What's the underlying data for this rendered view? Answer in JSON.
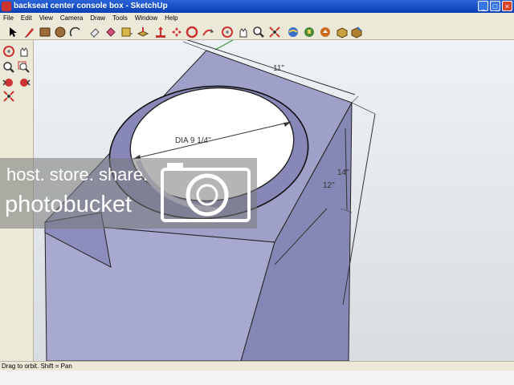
{
  "window": {
    "title": "backseat center console box - SketchUp",
    "minimize_glyph": "_",
    "maximize_glyph": "□",
    "close_glyph": "×"
  },
  "menu": {
    "items": [
      "File",
      "Edit",
      "View",
      "Camera",
      "Draw",
      "Tools",
      "Window",
      "Help"
    ]
  },
  "toolbar": {
    "icons": [
      "select-icon",
      "pencil-icon",
      "rectangle-icon",
      "circle-icon",
      "arc-icon",
      "eraser-icon",
      "paint-bucket-icon",
      "tape-measure-icon",
      "push-pull-icon",
      "move-icon",
      "rotate-icon",
      "offset-icon",
      "orbit-icon",
      "pan-icon",
      "zoom-icon",
      "zoom-extents-icon",
      "google-earth-icon",
      "get-models-icon",
      "share-model-icon",
      "components-icon",
      "get-photo-texture-icon"
    ]
  },
  "left_toolbar": {
    "icons": [
      "orbit-icon",
      "pan-icon",
      "zoom-icon",
      "zoom-window-icon",
      "previous-view-icon",
      "next-view-icon",
      "zoom-extents-icon"
    ]
  },
  "viewport": {
    "dimensions": {
      "width": "11\"",
      "depth": "14\"",
      "height": "12\"",
      "diameter": "DIA 9 1/4\""
    }
  },
  "watermark": {
    "line1": "host. store. share.",
    "line2": "photobucket"
  },
  "status": {
    "text": "Drag to orbit.  Shift = Pan"
  },
  "colors": {
    "box_top": "#9ea0c8",
    "box_front": "#a8a9cf",
    "box_side": "#8587b4",
    "accent_blue": "#0a3fb5"
  }
}
